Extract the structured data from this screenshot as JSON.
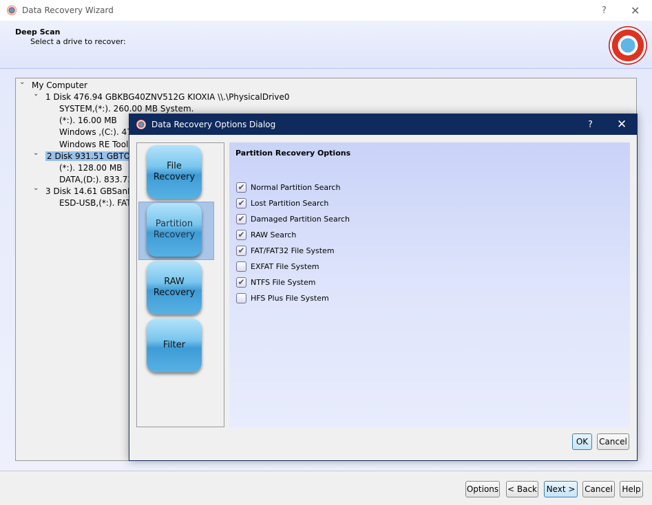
{
  "window": {
    "title": "Data Recovery Wizard",
    "help": "?",
    "close": "✕"
  },
  "header": {
    "title": "Deep Scan",
    "subtitle": "Select a drive to recover:"
  },
  "tree": [
    {
      "label": "My Computer",
      "level": 0,
      "chevron": true
    },
    {
      "label": "1 Disk 476.94 GBKBG40ZNV512G KIOXIA  \\\\.\\PhysicalDrive0",
      "level": 1,
      "chevron": true
    },
    {
      "label": "SYSTEM,(*:).   260.00 MB System.",
      "level": 2
    },
    {
      "label": "(*:).   16.00 MB",
      "level": 2
    },
    {
      "label": "Windows ,(C:).   475",
      "level": 2
    },
    {
      "label": "Windows RE Tools,(",
      "level": 2
    },
    {
      "label": "2 Disk 931.51 GBTOSHIB",
      "level": 1,
      "chevron": true,
      "selected": true
    },
    {
      "label": "(*:).   128.00 MB",
      "level": 2
    },
    {
      "label": "DATA,(D:).   833.73 G",
      "level": 2
    },
    {
      "label": "3 Disk 14.61 GBSanDisk",
      "level": 1,
      "chevron": true
    },
    {
      "label": "ESD-USB,(*:).  FAT32",
      "level": 2
    }
  ],
  "dialog": {
    "title": "Data Recovery Options Dialog",
    "help": "?",
    "close": "✕",
    "nav": [
      {
        "line1": "File",
        "line2": "Recovery"
      },
      {
        "line1": "Partition",
        "line2": "Recovery",
        "selected": true
      },
      {
        "line1": "RAW",
        "line2": "Recovery"
      },
      {
        "line1": "Filter",
        "line2": ""
      }
    ],
    "section_title": "Partition Recovery Options",
    "options": [
      {
        "label": "Normal Partition Search",
        "checked": true
      },
      {
        "label": "Lost Partition Search",
        "checked": true
      },
      {
        "label": "Damaged Partition Search",
        "checked": true
      },
      {
        "label": "RAW Search",
        "checked": true
      },
      {
        "label": "FAT/FAT32 File System",
        "checked": true
      },
      {
        "label": "EXFAT File System",
        "checked": false
      },
      {
        "label": "NTFS File System",
        "checked": true
      },
      {
        "label": "HFS Plus File System",
        "checked": false
      }
    ],
    "ok": "OK",
    "cancel": "Cancel"
  },
  "footer": {
    "options": "Options",
    "back": "< Back",
    "next": "Next >",
    "cancel": "Cancel",
    "help": "Help"
  }
}
